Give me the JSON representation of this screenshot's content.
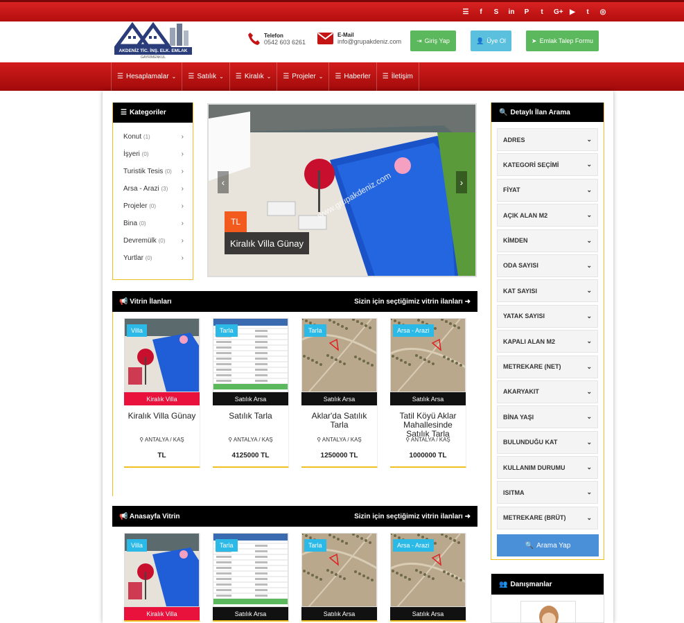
{
  "social_icons": [
    "list-icon",
    "facebook-icon",
    "skype-icon",
    "linkedin-icon",
    "pinterest-icon",
    "tumblr-icon",
    "google-plus-icon",
    "youtube-icon",
    "twitter-icon",
    "instagram-icon"
  ],
  "social_glyphs": [
    "☰",
    "f",
    "S",
    "in",
    "P",
    "t",
    "G+",
    "▶",
    "t",
    "◎"
  ],
  "logo": {
    "line1": "AKDENİZ TİC. İNŞ. ELK. EMLAK",
    "line2": "GAYRİMENKUL"
  },
  "contact": {
    "phone_label": "Telefon",
    "phone": "0542 603 6261",
    "email_label": "E-Mail",
    "email": "info@grupakdeniz.com"
  },
  "buttons": {
    "login": "Giriş Yap",
    "register": "Üye Ol",
    "request": "Emlak Talep Formu"
  },
  "nav": [
    {
      "label": "Hesaplamalar",
      "dropdown": true
    },
    {
      "label": "Satılık",
      "dropdown": true
    },
    {
      "label": "Kiralık",
      "dropdown": true
    },
    {
      "label": "Projeler",
      "dropdown": true
    },
    {
      "label": "Haberler",
      "dropdown": false
    },
    {
      "label": "İletişim",
      "dropdown": false
    }
  ],
  "categories": {
    "title": "Kategoriler",
    "items": [
      {
        "name": "Konut",
        "count": "(1)"
      },
      {
        "name": "İşyeri",
        "count": "(0)"
      },
      {
        "name": "Turistik Tesis",
        "count": "(0)"
      },
      {
        "name": "Arsa - Arazi",
        "count": "(3)"
      },
      {
        "name": "Projeler",
        "count": "(0)"
      },
      {
        "name": "Bina",
        "count": "(0)"
      },
      {
        "name": "Devremülk",
        "count": "(0)"
      },
      {
        "name": "Yurtlar",
        "count": "(0)"
      }
    ]
  },
  "slider": {
    "price": "TL",
    "caption": "Kiralık Villa Günay",
    "watermark": "www.grupakdeniz.com"
  },
  "vitrin": {
    "title": "Vitrin İlanları",
    "link": "Sizin için seçtiğimiz vitrin ilanları",
    "cards": [
      {
        "badge": "Villa",
        "strip": "Kiralık Villa",
        "strip_color": "#e8123c",
        "title": "Kiralık Villa Günay",
        "location": "ANTALYA / KAŞ",
        "price": "TL",
        "img": "pool"
      },
      {
        "badge": "Tarla",
        "strip": "Satılık Arsa",
        "strip_color": "#111",
        "title": "Satılık Tarla",
        "location": "ANTALYA / KAŞ",
        "price": "4125000 TL",
        "img": "doc"
      },
      {
        "badge": "Tarla",
        "strip": "Satılık Arsa",
        "strip_color": "#111",
        "title": "Aklar'da Satılık Tarla",
        "location": "ANTALYA / KAŞ",
        "price": "1250000 TL",
        "img": "map"
      },
      {
        "badge": "Arsa - Arazi",
        "strip": "Satılık Arsa",
        "strip_color": "#111",
        "title": "Tatil Köyü Aklar Mahallesinde Satılık Tarla",
        "location": "ANTALYA / KAŞ",
        "price": "1000000 TL",
        "img": "map2"
      }
    ]
  },
  "anasayfa": {
    "title": "Anasayfa Vitrin",
    "link": "Sizin için seçtiğimiz vitrin ilanları",
    "cards": [
      {
        "badge": "Villa",
        "strip": "Kiralık Villa",
        "strip_color": "#e8123c",
        "img": "pool"
      },
      {
        "badge": "Tarla",
        "strip": "Satılık Arsa",
        "strip_color": "#111",
        "img": "doc"
      },
      {
        "badge": "Tarla",
        "strip": "Satılık Arsa",
        "strip_color": "#111",
        "img": "map"
      },
      {
        "badge": "Arsa - Arazi",
        "strip": "Satılık Arsa",
        "strip_color": "#111",
        "img": "map2"
      }
    ]
  },
  "search": {
    "title": "Detaylı İlan Arama",
    "filters": [
      "ADRES",
      "KATEGORİ SEÇİMİ",
      "FİYAT",
      "AÇIK ALAN M2",
      "KİMDEN",
      "ODA SAYISI",
      "KAT SAYISI",
      "YATAK SAYISI",
      "KAPALI ALAN M2",
      "METREKARE (NET)",
      "AKARYAKIT",
      "BİNA YAŞI",
      "BULUNDUĞU KAT",
      "KULLANIM DURUMU",
      "ISITMA",
      "METREKARE (BRÜT)"
    ],
    "button": "Arama Yap"
  },
  "advisors": {
    "title": "Danışmanlar"
  },
  "colors": {
    "red": "#c41414",
    "green": "#5cb85c",
    "blue": "#5bc0de",
    "search_button": "#4a90d9",
    "gold": "#f0c020"
  }
}
